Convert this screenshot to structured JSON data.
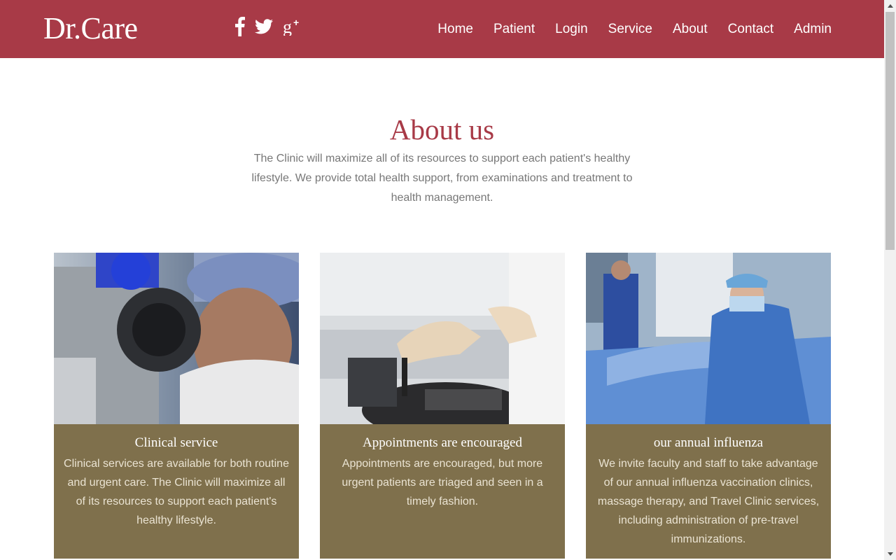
{
  "brand": {
    "logo_text": "Dr.Care",
    "color": "#a83a47"
  },
  "social": [
    {
      "icon": "facebook-icon"
    },
    {
      "icon": "twitter-icon"
    },
    {
      "icon": "google-plus-icon"
    }
  ],
  "nav": {
    "items": [
      {
        "label": "Home"
      },
      {
        "label": "Patient"
      },
      {
        "label": "Login"
      },
      {
        "label": "Service"
      },
      {
        "label": "About"
      },
      {
        "label": "Contact"
      },
      {
        "label": "Admin"
      }
    ]
  },
  "about": {
    "title": "About us",
    "description": "The Clinic will maximize all of its resources to support each patient's healthy lifestyle. We provide total health support, from examinations and treatment to health management."
  },
  "cards": [
    {
      "title": "Clinical service",
      "text": "Clinical services are available for both routine and urgent care. The Clinic will maximize all of its resources to support each patient's healthy lifestyle.",
      "image": "doctor-microscope-photo"
    },
    {
      "title": "Appointments are encouraged",
      "text": "Appointments are encouraged, but more urgent patients are triaged and seen in a timely fashion.",
      "image": "lab-test-tube-photo"
    },
    {
      "title": "our annual influenza",
      "text": "We invite faculty and staff to take advantage of our annual influenza vaccination clinics, massage therapy, and Travel Clinic services, including administration of pre-travel immunizations.",
      "image": "surgery-room-photo"
    }
  ],
  "colors": {
    "card_bg": "#7f704c",
    "card_text": "#eae3d2",
    "desc_text": "#777777"
  }
}
